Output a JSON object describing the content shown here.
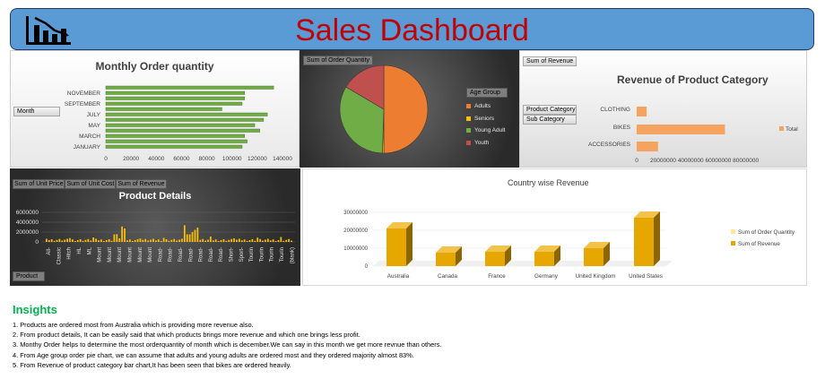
{
  "header": {
    "title": "Sales Dashboard"
  },
  "monthly": {
    "title": "Monthly Order quantity",
    "filter_label": "Month",
    "months": [
      "NOVEMBER",
      "SEPTEMBER",
      "JULY",
      "MAY",
      "MARCH",
      "JANUARY"
    ],
    "bar_values": [
      133000,
      110000,
      110000,
      108000,
      92000,
      128000,
      125000,
      118000,
      122000,
      110000,
      112000,
      108000
    ],
    "xticks": [
      "0",
      "20000",
      "40000",
      "60000",
      "80000",
      "100000",
      "120000",
      "140000"
    ],
    "xmax": 140000,
    "bar_color": "#70ad47"
  },
  "age": {
    "field_label": "Sum of Order Quantity",
    "legend_title": "Age Group",
    "segments": [
      {
        "name": "Adults",
        "value": 50,
        "color": "#ed7d31"
      },
      {
        "name": "Seniors",
        "value": 0.5,
        "color": "#ffc000"
      },
      {
        "name": "Young Adult",
        "value": 33,
        "color": "#70ad47"
      },
      {
        "name": "Youth",
        "value": 16.5,
        "color": "#c0504d"
      }
    ]
  },
  "category": {
    "field_label": "Sum of Revenue",
    "title": "Revenue of Product Category",
    "filter1": "Product Category",
    "filter2": "Sub Category",
    "categories": [
      "CLOTHING",
      "BIKES",
      "ACCESSORIES"
    ],
    "values": [
      7000000,
      62000000,
      15000000
    ],
    "xticks": [
      "0",
      "20000000",
      "40000000",
      "60000000",
      "80000000"
    ],
    "xmax": 80000000,
    "legend": "Total",
    "bar_color": "#f4a460"
  },
  "product": {
    "title": "Product Details",
    "chips": [
      "Sum of Unit Price",
      "Sum of Unit Cost",
      "Sum of Revenue"
    ],
    "yticks": [
      "6000000",
      "4000000",
      "2000000",
      "0"
    ],
    "xlabels": [
      "All-",
      "Classic",
      "Hitch",
      "HL",
      "ML",
      "Mount",
      "Mount",
      "Mount",
      "Mount",
      "Mount",
      "Mount",
      "Road-",
      "Road-",
      "Road-",
      "Road-",
      "Road-",
      "Road-",
      "Road-",
      "Short-",
      "Sport-",
      "Tourin",
      "Tourin",
      "Tourin",
      "Tourin",
      "(blank)"
    ],
    "filter_label": "Product"
  },
  "country": {
    "title": "Country wise Revenue",
    "categories": [
      "Australia",
      "Canada",
      "France",
      "Germany",
      "United Kingdom",
      "United States"
    ],
    "values": [
      21000000,
      7500000,
      8000000,
      8000000,
      10000000,
      27000000
    ],
    "yticks": [
      "30000000",
      "20000000",
      "10000000",
      "0"
    ],
    "ymax": 30000000,
    "legend": [
      "Sum of Order Quantity",
      "Sum of Revenue"
    ],
    "bar_color": "#e6a800"
  },
  "insights": {
    "title": "Insights",
    "items": [
      "1. Products are ordered most from Australia which is providing more revenue also.",
      "2. From product details, It can be easily said that which products brings more revenue and which one brings less profit.",
      "3. Monthy Order helps to determine the most orderquantity of month which is december.We can say in this month we get more revnue than others.",
      "4. From Age group order pie chart, we can assume that adults and young adults are ordered most and they ordered majority almost 83%.",
      "5. From Revenue of product category bar chart,It has been seen that bikes are ordered heavily."
    ]
  }
}
